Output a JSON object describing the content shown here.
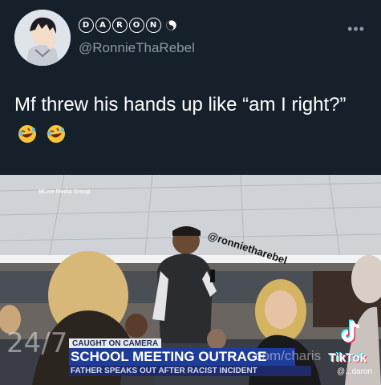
{
  "tweet": {
    "display_name_letters": [
      "D",
      "A",
      "R",
      "O",
      "N"
    ],
    "handle": "@RonnieThaRebel",
    "more_label": "•••",
    "text": "Mf threw his hands up like “am I right?”"
  },
  "video": {
    "source_label": "MLive Media Group",
    "watermark_handle": "@ronnietharebel",
    "overlay_247": "24/7",
    "news_tag": "CAUGHT ON CAMERA",
    "headline": "SCHOOL MEETING OUTRAGE",
    "subheadline": "FATHER SPEAKS OUT AFTER RACIST INCIDENT",
    "url_watermark": "com/charis",
    "tiktok_label": "TikTok",
    "tiktok_user": "@...daron"
  },
  "colors": {
    "background": "#15202b",
    "text_primary": "#ffffff",
    "text_secondary": "#8b98a5",
    "news_blue": "#1e3c9a"
  },
  "icons": [
    "avatar-image",
    "yin-yang-icon",
    "more-icon",
    "laughing-emoji-icon",
    "tiktok-logo-icon"
  ]
}
